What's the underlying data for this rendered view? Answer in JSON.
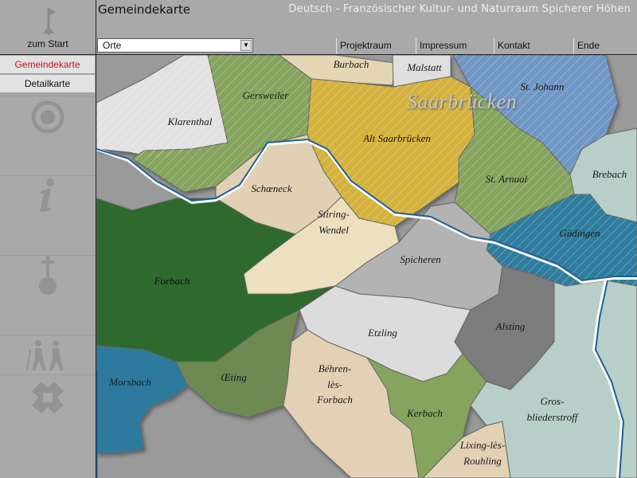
{
  "header": {
    "page_title": "Gemeindekarte",
    "site_title": "Deutsch - Französischer Kultur- und Naturraum Spicherer Höhen",
    "home_label": "zum Start",
    "dropdown": {
      "selected": "Orte"
    },
    "nav": [
      {
        "label": "Projektraum"
      },
      {
        "label": "Impressum"
      },
      {
        "label": "Kontakt"
      },
      {
        "label": "Ende"
      }
    ]
  },
  "sidebar": {
    "buttons": [
      {
        "label": "Gemeindekarte",
        "active": true
      },
      {
        "label": "Detailkarte",
        "active": false
      }
    ],
    "icons": [
      "target-icon",
      "info-icon",
      "cross-globe-icon",
      "hikers-icon",
      "emblem-icon"
    ]
  },
  "map": {
    "city_label": "Saarbrücken",
    "places": [
      {
        "name": "Burbach"
      },
      {
        "name": "Malstatt"
      },
      {
        "name": "St. Johann"
      },
      {
        "name": "Gersweiler"
      },
      {
        "name": "Klarenthal"
      },
      {
        "name": "Alt Saarbrücken"
      },
      {
        "name": "Brebach"
      },
      {
        "name": "St. Arnual"
      },
      {
        "name": "Schœneck"
      },
      {
        "name": "Stiring-\nWendel"
      },
      {
        "name": "Güdingen"
      },
      {
        "name": "Forbach"
      },
      {
        "name": "Spicheren"
      },
      {
        "name": "Etzling"
      },
      {
        "name": "Alsting"
      },
      {
        "name": "Morsbach"
      },
      {
        "name": "Œting"
      },
      {
        "name": "Béhren-\nlès-\nForbach"
      },
      {
        "name": "Kerbach"
      },
      {
        "name": "Gros-\nbliederstroff"
      },
      {
        "name": "Lixing-lès-\nRouhling"
      }
    ]
  },
  "colors": {
    "background": "#a9a9a9",
    "active_text": "#c0141c",
    "saarbruecken_gold": "#d4b23e",
    "forbach_green": "#2f6a2f",
    "river_blue": "#1f5f96"
  }
}
